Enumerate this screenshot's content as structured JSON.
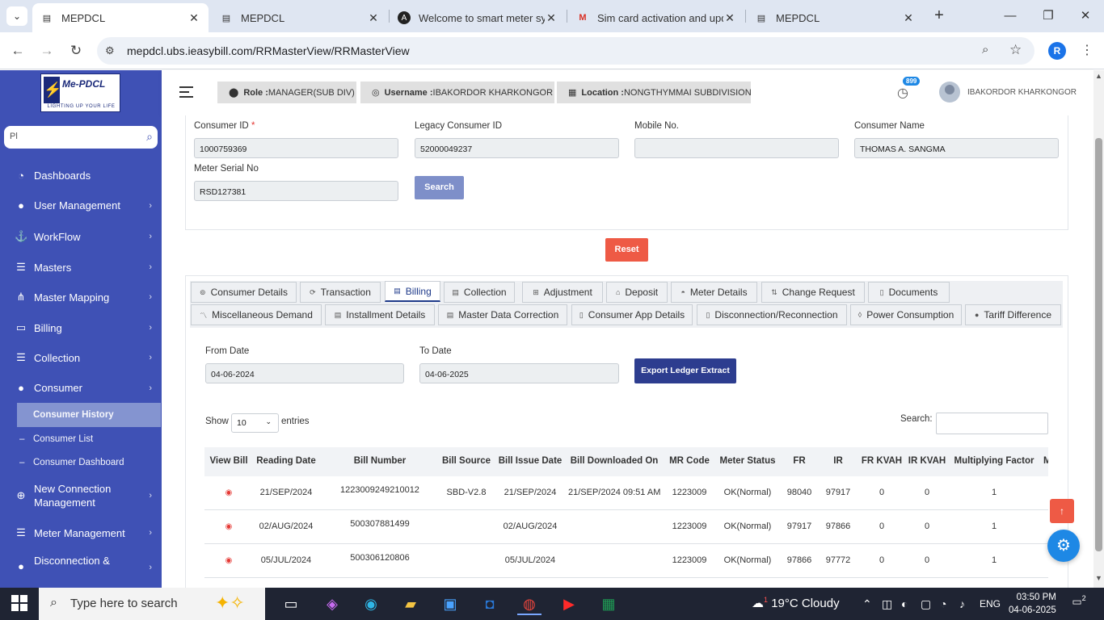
{
  "browser": {
    "tabs": [
      {
        "title": "MEPDCL",
        "active": true
      },
      {
        "title": "MEPDCL",
        "active": false
      },
      {
        "title": "Welcome to smart meter sys",
        "active": false
      },
      {
        "title": "Sim card activation and upd",
        "active": false
      },
      {
        "title": "MEPDCL",
        "active": false
      }
    ],
    "url": "mepdcl.ubs.ieasybill.com/RRMasterView/RRMasterView",
    "profile_initial": "R"
  },
  "logo": {
    "brand": "Me-PDCL",
    "tagline": "LIGHTING UP YOUR LIFE"
  },
  "sidebar": {
    "search_value": "Pl",
    "items": [
      {
        "label": "Dashboards",
        "icon": "dashboard-icon",
        "chevron": false
      },
      {
        "label": "User Management",
        "icon": "user-icon",
        "chevron": true
      },
      {
        "label": "WorkFlow",
        "icon": "anchor-icon",
        "chevron": true
      },
      {
        "label": "Masters",
        "icon": "list-icon",
        "chevron": true
      },
      {
        "label": "Master Mapping",
        "icon": "sitemap-icon",
        "chevron": true
      },
      {
        "label": "Billing",
        "icon": "monitor-icon",
        "chevron": true
      },
      {
        "label": "Collection",
        "icon": "list-icon",
        "chevron": true
      },
      {
        "label": "Consumer",
        "icon": "user-icon",
        "chevron": true
      }
    ],
    "submenu": [
      {
        "label": "Consumer History",
        "active": true
      },
      {
        "label": "Consumer List",
        "active": false
      },
      {
        "label": "Consumer Dashboard",
        "active": false
      }
    ],
    "items2": [
      {
        "label": "New Connection Management",
        "icon": "plus-circle-icon",
        "chevron": true
      },
      {
        "label": "Meter Management",
        "icon": "list-icon",
        "chevron": true
      },
      {
        "label": "Disconnection &",
        "icon": "user-icon",
        "chevron": true
      }
    ]
  },
  "header": {
    "role_label": "Role :",
    "role_value": "MANAGER(SUB DIV)",
    "username_label": "Username :",
    "username_value": "IBAKORDOR KHARKONGOR",
    "location_label": "Location :",
    "location_value": "NONGTHYMMAI SUBDIVISION",
    "notification_count": "899",
    "user_display": "IBAKORDOR KHARKONGOR"
  },
  "search_form": {
    "consumer_id_label": "Consumer ID",
    "consumer_id_required": "*",
    "consumer_id_value": "1000759369",
    "legacy_id_label": "Legacy Consumer ID",
    "legacy_id_value": "52000049237",
    "mobile_label": "Mobile No.",
    "mobile_value": "",
    "name_label": "Consumer Name",
    "name_value": "THOMAS A. SANGMA",
    "meter_serial_label": "Meter Serial No",
    "meter_serial_value": "RSD127381",
    "search_button": "Search",
    "reset_button": "Reset"
  },
  "detail_tabs_row1": [
    {
      "label": "Consumer Details",
      "icon": "⊚",
      "active": false
    },
    {
      "label": "Transaction",
      "icon": "⟳",
      "active": false
    },
    {
      "label": "Billing",
      "icon": "▤",
      "active": true
    },
    {
      "label": "Collection",
      "icon": "▤",
      "active": false
    },
    {
      "label": "Adjustment",
      "icon": "⊞",
      "active": false
    },
    {
      "label": "Deposit",
      "icon": "⌂",
      "active": false
    },
    {
      "label": "Meter Details",
      "icon": "◓",
      "active": false
    },
    {
      "label": "Change Request",
      "icon": "⇅",
      "active": false
    },
    {
      "label": "Documents",
      "icon": "▯",
      "active": false
    }
  ],
  "detail_tabs_row2": [
    {
      "label": "Miscellaneous Demand",
      "icon": "〽",
      "active": false
    },
    {
      "label": "Installment Details",
      "icon": "▤",
      "active": false
    },
    {
      "label": "Master Data Correction",
      "icon": "▤",
      "active": false
    },
    {
      "label": "Consumer App Details",
      "icon": "▯",
      "active": false
    },
    {
      "label": "Disconnection/Reconnection",
      "icon": "▯",
      "active": false
    },
    {
      "label": "Power Consumption",
      "icon": "◊",
      "active": false
    },
    {
      "label": "Tariff Difference",
      "icon": "●",
      "active": false
    }
  ],
  "billing": {
    "from_date_label": "From Date",
    "from_date_value": "04-06-2024",
    "to_date_label": "To Date",
    "to_date_value": "04-06-2025",
    "export_button": "Export Ledger Extract",
    "show_label": "Show",
    "entries_value": "10",
    "entries_label": "entries",
    "search_label": "Search:",
    "columns": [
      "View Bill",
      "Reading Date",
      "Bill Number",
      "Bill Source",
      "Bill Issue Date",
      "Bill Downloaded On",
      "MR Code",
      "Meter Status",
      "FR",
      "IR",
      "FR KVAH",
      "IR KVAH",
      "Multiplying Factor",
      "M"
    ],
    "rows": [
      {
        "reading_date": "21/SEP/2024",
        "bill_number": "1223009249210012",
        "bill_source": "SBD-V2.8",
        "issue_date": "21/SEP/2024",
        "downloaded_on": "21/SEP/2024 09:51 AM",
        "mr_code": "1223009",
        "meter_status": "OK(Normal)",
        "fr": "98040",
        "ir": "97917",
        "fr_kvah": "0",
        "ir_kvah": "0",
        "mf": "1"
      },
      {
        "reading_date": "02/AUG/2024",
        "bill_number": "500307881499",
        "bill_source": "",
        "issue_date": "02/AUG/2024",
        "downloaded_on": "",
        "mr_code": "1223009",
        "meter_status": "OK(Normal)",
        "fr": "97917",
        "ir": "97866",
        "fr_kvah": "0",
        "ir_kvah": "0",
        "mf": "1"
      },
      {
        "reading_date": "05/JUL/2024",
        "bill_number": "500306120806",
        "bill_source": "",
        "issue_date": "05/JUL/2024",
        "downloaded_on": "",
        "mr_code": "1223009",
        "meter_status": "OK(Normal)",
        "fr": "97866",
        "ir": "97772",
        "fr_kvah": "0",
        "ir_kvah": "0",
        "mf": "1"
      }
    ]
  },
  "taskbar": {
    "search_placeholder": "Type here to search",
    "weather_badge": "1",
    "weather": "19°C  Cloudy",
    "language": "ENG",
    "time": "03:50 PM",
    "date": "04-06-2025",
    "notifications": "2"
  }
}
